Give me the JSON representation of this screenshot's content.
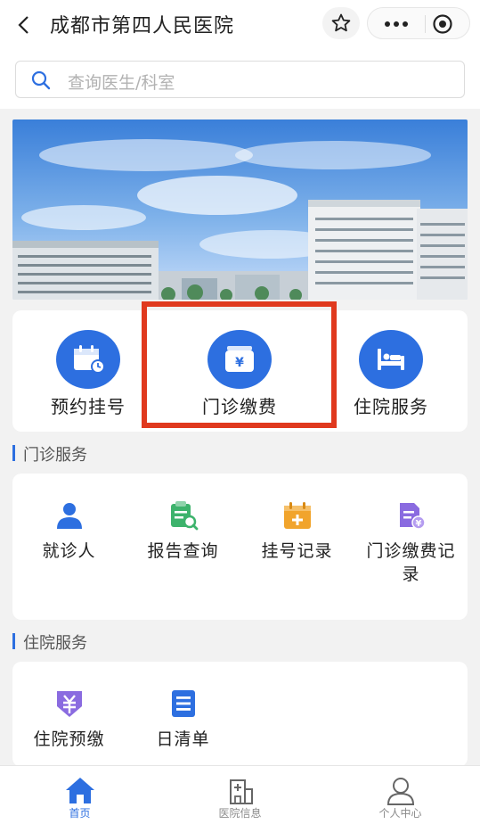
{
  "header": {
    "title": "成都市第四人民医院"
  },
  "search": {
    "placeholder": "查询医生/科室"
  },
  "quick_actions": [
    {
      "label": "预约挂号",
      "icon": "calendar-clock-icon"
    },
    {
      "label": "门诊缴费",
      "icon": "wallet-yuan-icon"
    },
    {
      "label": "住院服务",
      "icon": "bed-icon"
    }
  ],
  "outpatient": {
    "title": "门诊服务",
    "items": [
      {
        "label": "就诊人",
        "icon": "person-icon"
      },
      {
        "label": "报告查询",
        "icon": "report-search-icon"
      },
      {
        "label": "挂号记录",
        "icon": "calendar-add-icon"
      },
      {
        "label_line1": "门诊缴费记",
        "label_line2": "录",
        "icon": "payment-record-icon"
      }
    ]
  },
  "inpatient": {
    "title": "住院服务",
    "items": [
      {
        "label": "住院预缴",
        "icon": "yuan-badge-icon"
      },
      {
        "label": "日清单",
        "icon": "list-doc-icon"
      }
    ]
  },
  "tabbar": {
    "items": [
      {
        "label": "首页",
        "icon": "home-icon",
        "active": true
      },
      {
        "label": "医院信息",
        "icon": "hospital-building-icon",
        "active": false
      },
      {
        "label": "个人中心",
        "icon": "user-center-icon",
        "active": false
      }
    ]
  },
  "colors": {
    "primary": "#2d6fe0",
    "highlight": "#e0391e",
    "green": "#3db36c",
    "orange": "#f1a42c",
    "purple": "#8a6be0"
  }
}
